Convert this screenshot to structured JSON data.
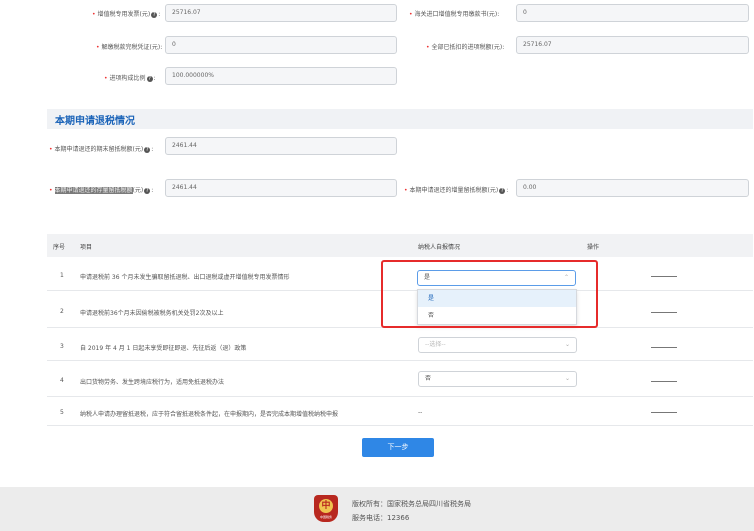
{
  "top_fields": {
    "vat_invoice_label": "增值税专用发票(元)",
    "vat_invoice_value": "25716.07",
    "customs_label": "海关进口增值税专用缴款书(元)",
    "customs_value": "0",
    "tax_voucher_label": "解缴税款完税凭证(元)",
    "tax_voucher_value": "0",
    "total_deducted_label": "全部已抵扣的进项税额(元)",
    "total_deducted_value": "25716.07",
    "ratio_label": "进项构成比例",
    "ratio_value": "100.000000%"
  },
  "section": {
    "title": "本期申请退税情况",
    "end_balance_label": "本期申请退还的期末留抵税额(元)",
    "end_balance_value": "2461.44",
    "stock_label": "本期申请退还的存量留抵税额",
    "stock_label_suffix": "(元)",
    "stock_value": "2461.44",
    "increment_label": "本期申请退还的增量留抵税额(元)",
    "increment_value": "0.00"
  },
  "table": {
    "headers": [
      "序号",
      "项目",
      "纳税人自报情况",
      "操作"
    ],
    "rows": [
      {
        "no": "1",
        "item": "申请退税前 36 个月未发生骗取留抵退税、出口退税或虚开增值税专用发票情形",
        "value": "是",
        "placeholder": "",
        "op": "—"
      },
      {
        "no": "2",
        "item": "申请退税前36个月未因偷税被税务机关处罚2次及以上",
        "value": "",
        "placeholder": "",
        "op": "—"
      },
      {
        "no": "3",
        "item": "自 2019 年 4 月 1 日起未享受即征即退、先征后返（退）政策",
        "value": "",
        "placeholder": "--选择--",
        "op": "—"
      },
      {
        "no": "4",
        "item": "出口货物劳务、发生跨境应税行为，适用免抵退税办法",
        "value": "否",
        "placeholder": "",
        "op": "—"
      },
      {
        "no": "5",
        "item": "纳税人申请办理留抵退税，应于符合留抵退税条件起，在申报期内，是否完成本期增值税纳税申报",
        "value": "--",
        "placeholder": "",
        "op": "—"
      }
    ],
    "dropdown_options": [
      "是",
      "否"
    ]
  },
  "buttons": {
    "next": "下一步"
  },
  "footer": {
    "copyright": "版权所有：国家税务总局四川省税务局",
    "phone": "服务电话：12366",
    "logo_glyph": "中",
    "logo_text": "中国税务"
  },
  "icons": {
    "help": "?",
    "chevron_up": "⌃",
    "chevron_down": "⌄"
  },
  "colors": {
    "accent": "#1a63b8",
    "button": "#2f87e6",
    "highlight_box": "#e62b2b"
  }
}
